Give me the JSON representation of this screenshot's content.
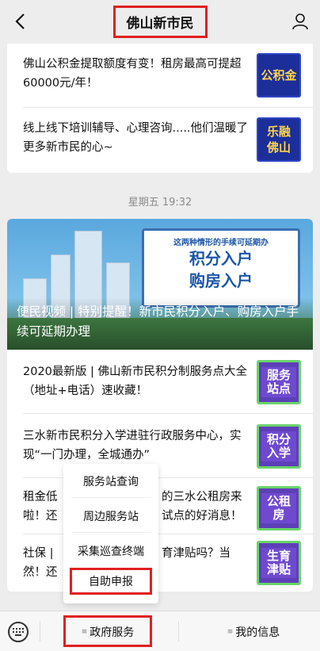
{
  "header": {
    "title": "佛山新市民",
    "back_icon": "chevron-left-icon",
    "profile_icon": "person-icon"
  },
  "top_articles": [
    {
      "text": "佛山公积金提取额度有变！租房最高可提超60000元/年！",
      "thumb": "公积金"
    },
    {
      "text": "线上线下培训辅导、心理咨询.....他们温暖了更多新市民的心~",
      "thumb": "乐融佛山"
    }
  ],
  "timestamp": "星期五 19:32",
  "banner": {
    "sign_small": "这两种情形的手续可延期办",
    "sign_line1": "积分入户",
    "sign_line2": "购房入户",
    "headline": "便民视频 | 特别提醒！新市民积分入户、购房入户手续可延期办理"
  },
  "articles": [
    {
      "text": "2020最新版 | 佛山新市民积分制服务点大全（地址+电话）速收藏！",
      "thumb": "服务站点"
    },
    {
      "text": "三水新市民积分入学进驻行政服务中心，实现“一门办理，全城通办”",
      "thumb": "积分入学"
    },
    {
      "text": "租金低 ... 的三水公租房来啦！还 ... 试点的好消息！",
      "text_left": "租金低",
      "text_right": "的三水公租房来",
      "text_left2": "啦！还",
      "text_right2": "试点的好消息！",
      "thumb": "公租房"
    },
    {
      "text_left": "社保 |",
      "text_right": "育津贴吗？当",
      "text_left2": "然！还",
      "thumb": "生育津贴"
    }
  ],
  "popup_menu": {
    "items": [
      "服务站查询",
      "周边服务站",
      "采集巡查终端",
      "自助申报"
    ]
  },
  "bottom_bar": {
    "keyboard_icon": "keyboard-icon",
    "tab_gov": "政府服务",
    "tab_mine": "我的信息",
    "menu_glyph": "≡"
  },
  "colors": {
    "highlight": "#e02020",
    "thumb_blue": "#1c2e9a",
    "thumb_purple": "#5d3fb8",
    "thumb_green_border": "#6bd36b"
  }
}
